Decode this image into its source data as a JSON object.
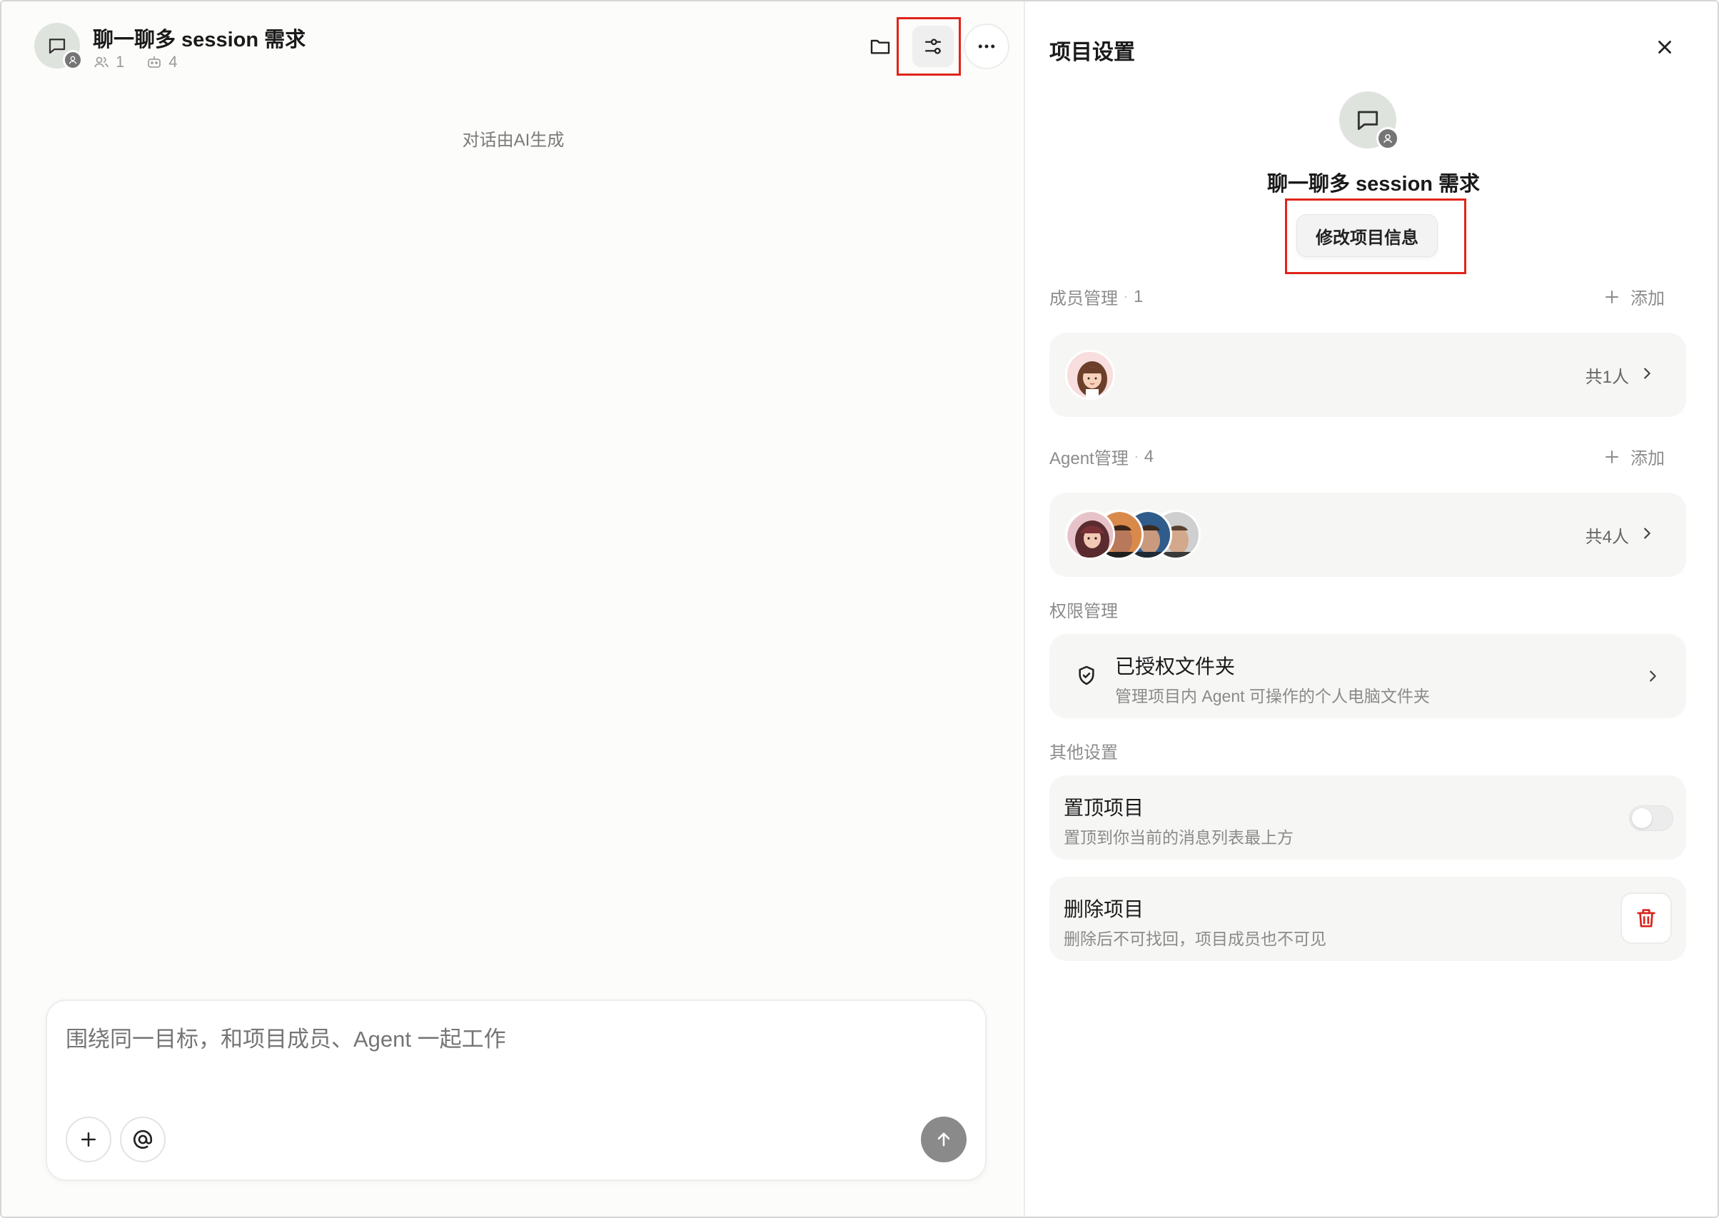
{
  "chat": {
    "project_name": "聊一聊多 session 需求",
    "member_count": "1",
    "agent_count": "4",
    "ai_note": "对话由AI生成",
    "composer_placeholder": "围绕同一目标，和项目成员、Agent 一起工作",
    "header_icons": [
      "folder-icon",
      "settings-sliders-icon",
      "more-icon"
    ],
    "composer_icons": [
      "plus-icon",
      "at-icon",
      "send-arrow-icon"
    ]
  },
  "settings": {
    "title": "项目设置",
    "project_name": "聊一聊多 session 需求",
    "edit_label": "修改项目信息",
    "members": {
      "label": "成员管理",
      "dot": "·",
      "count": "1",
      "add_label": "添加",
      "total": "共1人"
    },
    "agents": {
      "label": "Agent管理",
      "dot": "·",
      "count": "4",
      "add_label": "添加",
      "total": "共4人"
    },
    "permissions": {
      "label": "权限管理",
      "folder_title": "已授权文件夹",
      "folder_desc": "管理项目内 Agent 可操作的个人电脑文件夹"
    },
    "other": {
      "label": "其他设置",
      "pin_title": "置顶项目",
      "pin_desc": "置顶到你当前的消息列表最上方",
      "pin_enabled": false,
      "delete_title": "删除项目",
      "delete_desc": "删除后不可找回，项目成员也不可见"
    }
  },
  "colors": {
    "highlight": "#e0241a",
    "danger": "#d9241b",
    "chat_bg": "#fcfcfa",
    "card_bg": "#f6f6f5",
    "send_button": "#8a8a8a"
  }
}
